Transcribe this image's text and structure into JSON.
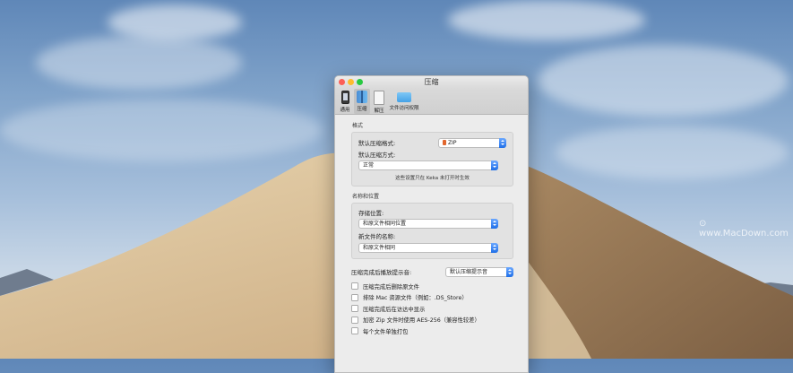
{
  "window": {
    "title": "压缩"
  },
  "toolbar": {
    "items": [
      {
        "label": "通用",
        "icon": "phone-icon"
      },
      {
        "label": "压缩",
        "icon": "compress-icon",
        "active": true
      },
      {
        "label": "解压",
        "icon": "extract-icon"
      },
      {
        "label": "文件访问权限",
        "icon": "folder-icon"
      }
    ]
  },
  "format": {
    "section_title": "格式",
    "default_format_label": "默认压缩格式:",
    "default_format_value": "ZIP",
    "default_method_label": "默认压缩方式:",
    "default_method_value": "正常",
    "note": "这些设置只在 Keka 未打开时生效"
  },
  "location": {
    "section_title": "名称和位置",
    "save_location_label": "存储位置:",
    "save_location_value": "和原文件相同位置",
    "new_name_label": "新文件的名称:",
    "new_name_value": "和原文件相同"
  },
  "sound": {
    "label": "压缩完成后播放提示音:",
    "value": "默认压缩提示音"
  },
  "options": [
    {
      "label": "压缩完成后删除原文件",
      "checked": false
    },
    {
      "label": "排除 Mac 资源文件（例如：.DS_Store）",
      "checked": false
    },
    {
      "label": "压缩完成后在访达中显示",
      "checked": false
    },
    {
      "label": "加密 Zip 文件时使用 AES-256（兼容性较差）",
      "checked": false
    },
    {
      "label": "每个文件单独打包",
      "checked": false
    }
  ],
  "colors": {
    "close": "#fc5f57",
    "minimize": "#fdbc2e",
    "maximize": "#28c940",
    "select_accent": "#1f6fe8"
  }
}
